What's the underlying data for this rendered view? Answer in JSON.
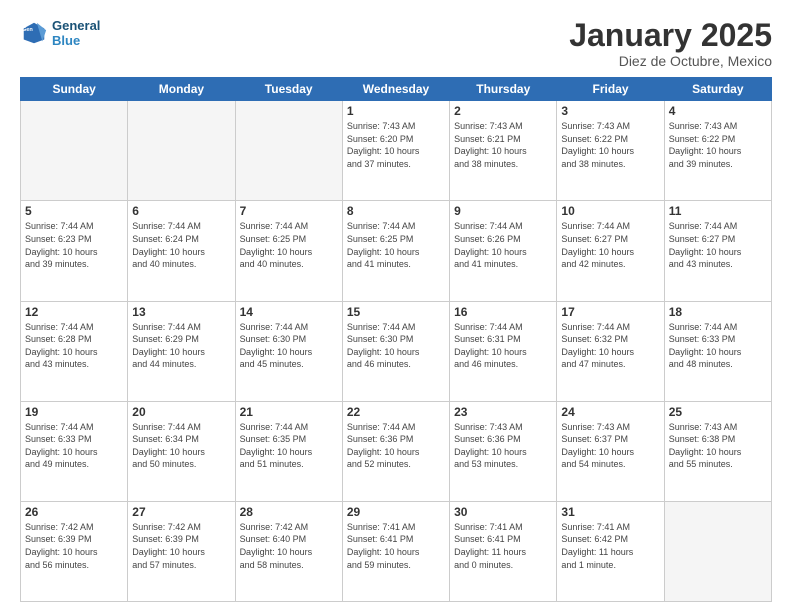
{
  "header": {
    "logo_line1": "General",
    "logo_line2": "Blue",
    "month": "January 2025",
    "location": "Diez de Octubre, Mexico"
  },
  "days_of_week": [
    "Sunday",
    "Monday",
    "Tuesday",
    "Wednesday",
    "Thursday",
    "Friday",
    "Saturday"
  ],
  "weeks": [
    [
      {
        "day": "",
        "info": ""
      },
      {
        "day": "",
        "info": ""
      },
      {
        "day": "",
        "info": ""
      },
      {
        "day": "1",
        "info": "Sunrise: 7:43 AM\nSunset: 6:20 PM\nDaylight: 10 hours\nand 37 minutes."
      },
      {
        "day": "2",
        "info": "Sunrise: 7:43 AM\nSunset: 6:21 PM\nDaylight: 10 hours\nand 38 minutes."
      },
      {
        "day": "3",
        "info": "Sunrise: 7:43 AM\nSunset: 6:22 PM\nDaylight: 10 hours\nand 38 minutes."
      },
      {
        "day": "4",
        "info": "Sunrise: 7:43 AM\nSunset: 6:22 PM\nDaylight: 10 hours\nand 39 minutes."
      }
    ],
    [
      {
        "day": "5",
        "info": "Sunrise: 7:44 AM\nSunset: 6:23 PM\nDaylight: 10 hours\nand 39 minutes."
      },
      {
        "day": "6",
        "info": "Sunrise: 7:44 AM\nSunset: 6:24 PM\nDaylight: 10 hours\nand 40 minutes."
      },
      {
        "day": "7",
        "info": "Sunrise: 7:44 AM\nSunset: 6:25 PM\nDaylight: 10 hours\nand 40 minutes."
      },
      {
        "day": "8",
        "info": "Sunrise: 7:44 AM\nSunset: 6:25 PM\nDaylight: 10 hours\nand 41 minutes."
      },
      {
        "day": "9",
        "info": "Sunrise: 7:44 AM\nSunset: 6:26 PM\nDaylight: 10 hours\nand 41 minutes."
      },
      {
        "day": "10",
        "info": "Sunrise: 7:44 AM\nSunset: 6:27 PM\nDaylight: 10 hours\nand 42 minutes."
      },
      {
        "day": "11",
        "info": "Sunrise: 7:44 AM\nSunset: 6:27 PM\nDaylight: 10 hours\nand 43 minutes."
      }
    ],
    [
      {
        "day": "12",
        "info": "Sunrise: 7:44 AM\nSunset: 6:28 PM\nDaylight: 10 hours\nand 43 minutes."
      },
      {
        "day": "13",
        "info": "Sunrise: 7:44 AM\nSunset: 6:29 PM\nDaylight: 10 hours\nand 44 minutes."
      },
      {
        "day": "14",
        "info": "Sunrise: 7:44 AM\nSunset: 6:30 PM\nDaylight: 10 hours\nand 45 minutes."
      },
      {
        "day": "15",
        "info": "Sunrise: 7:44 AM\nSunset: 6:30 PM\nDaylight: 10 hours\nand 46 minutes."
      },
      {
        "day": "16",
        "info": "Sunrise: 7:44 AM\nSunset: 6:31 PM\nDaylight: 10 hours\nand 46 minutes."
      },
      {
        "day": "17",
        "info": "Sunrise: 7:44 AM\nSunset: 6:32 PM\nDaylight: 10 hours\nand 47 minutes."
      },
      {
        "day": "18",
        "info": "Sunrise: 7:44 AM\nSunset: 6:33 PM\nDaylight: 10 hours\nand 48 minutes."
      }
    ],
    [
      {
        "day": "19",
        "info": "Sunrise: 7:44 AM\nSunset: 6:33 PM\nDaylight: 10 hours\nand 49 minutes."
      },
      {
        "day": "20",
        "info": "Sunrise: 7:44 AM\nSunset: 6:34 PM\nDaylight: 10 hours\nand 50 minutes."
      },
      {
        "day": "21",
        "info": "Sunrise: 7:44 AM\nSunset: 6:35 PM\nDaylight: 10 hours\nand 51 minutes."
      },
      {
        "day": "22",
        "info": "Sunrise: 7:44 AM\nSunset: 6:36 PM\nDaylight: 10 hours\nand 52 minutes."
      },
      {
        "day": "23",
        "info": "Sunrise: 7:43 AM\nSunset: 6:36 PM\nDaylight: 10 hours\nand 53 minutes."
      },
      {
        "day": "24",
        "info": "Sunrise: 7:43 AM\nSunset: 6:37 PM\nDaylight: 10 hours\nand 54 minutes."
      },
      {
        "day": "25",
        "info": "Sunrise: 7:43 AM\nSunset: 6:38 PM\nDaylight: 10 hours\nand 55 minutes."
      }
    ],
    [
      {
        "day": "26",
        "info": "Sunrise: 7:42 AM\nSunset: 6:39 PM\nDaylight: 10 hours\nand 56 minutes."
      },
      {
        "day": "27",
        "info": "Sunrise: 7:42 AM\nSunset: 6:39 PM\nDaylight: 10 hours\nand 57 minutes."
      },
      {
        "day": "28",
        "info": "Sunrise: 7:42 AM\nSunset: 6:40 PM\nDaylight: 10 hours\nand 58 minutes."
      },
      {
        "day": "29",
        "info": "Sunrise: 7:41 AM\nSunset: 6:41 PM\nDaylight: 10 hours\nand 59 minutes."
      },
      {
        "day": "30",
        "info": "Sunrise: 7:41 AM\nSunset: 6:41 PM\nDaylight: 11 hours\nand 0 minutes."
      },
      {
        "day": "31",
        "info": "Sunrise: 7:41 AM\nSunset: 6:42 PM\nDaylight: 11 hours\nand 1 minute."
      },
      {
        "day": "",
        "info": ""
      }
    ]
  ]
}
